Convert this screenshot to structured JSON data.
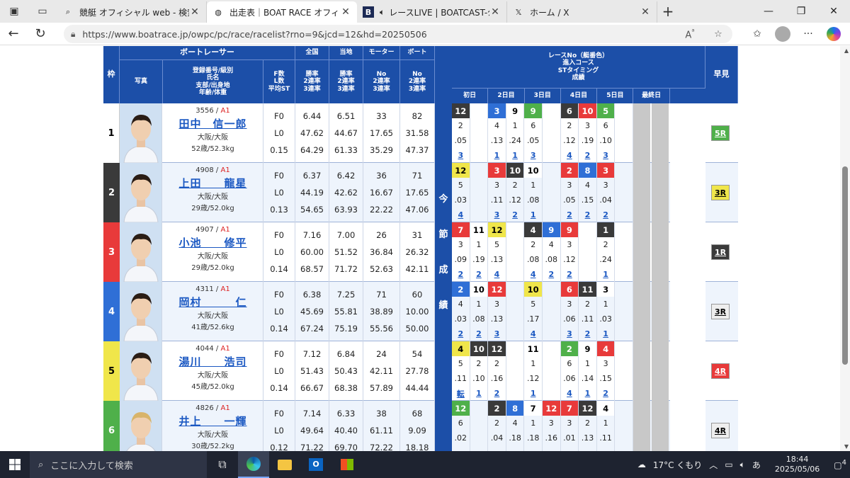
{
  "browser": {
    "tabs": [
      {
        "title": "競艇 オフィシャル web - 検索",
        "icon": "search-icon"
      },
      {
        "title": "出走表｜BOAT RACE オフィシャルウェブサイト",
        "icon": "globe-icon",
        "active": true
      },
      {
        "title": "レースLIVE | BOATCAST-公式ボートレース",
        "icon": "boatcast-icon"
      },
      {
        "title": "ホーム / X",
        "icon": "x-icon"
      }
    ],
    "url": "https://www.boatrace.jp/owpc/pc/race/racelist?rno=9&jcd=12&hd=20250506"
  },
  "header": {
    "waku": "枠",
    "boatracer": "ボートレーサー",
    "photo": "写真",
    "racer_sub": [
      "登録番号/級別",
      "氏名",
      "支部/出身地",
      "年齢/体重"
    ],
    "fl": [
      "F数",
      "L数",
      "平均ST"
    ],
    "zenkoku": "全国",
    "touchi": "当地",
    "motor": "モーター",
    "boat": "ボート",
    "rate_sub": [
      "勝率",
      "2連率",
      "3連率"
    ],
    "no_sub": [
      "No",
      "2連率",
      "3連率"
    ],
    "races_title": [
      "レースNo（艇番色）",
      "進入コース",
      "STタイミング",
      "成績"
    ],
    "days": [
      "初日",
      "2日目",
      "3日目",
      "4日目",
      "5日目",
      "最終日"
    ],
    "hayami": "早見",
    "konsetsu": [
      "今",
      "節",
      "成",
      "績"
    ]
  },
  "racers": [
    {
      "waku": "1",
      "reg": "3556",
      "cls": "A1",
      "name": "田中　信一郎",
      "branch": "大阪/大阪",
      "agewt": "52歳/52.3kg",
      "fl": [
        "F0",
        "L0",
        "0.15"
      ],
      "zenkoku": [
        "6.44",
        "47.62",
        "64.29"
      ],
      "touchi": [
        "6.51",
        "44.67",
        "61.33"
      ],
      "motor": [
        "33",
        "17.65",
        "35.29"
      ],
      "boat": [
        "82",
        "31.58",
        "47.37"
      ],
      "hayami": "5R",
      "races": [
        [
          "12",
          "",
          "3",
          "9",
          "9",
          "",
          "6",
          "10",
          "5",
          "",
          "",
          ""
        ],
        [
          "2",
          "",
          "4",
          "1",
          "6",
          "",
          "2",
          "3",
          "6",
          "",
          "",
          ""
        ],
        [
          ".05",
          "",
          ".13",
          ".24",
          ".05",
          "",
          ".12",
          ".19",
          ".10",
          "",
          "",
          ""
        ],
        [
          "3",
          "",
          "1",
          "1",
          "3",
          "",
          "4",
          "2",
          "3",
          "",
          "",
          ""
        ]
      ]
    },
    {
      "waku": "2",
      "reg": "4908",
      "cls": "A1",
      "name": "上田　　龍星",
      "branch": "大阪/大阪",
      "agewt": "29歳/52.0kg",
      "fl": [
        "F0",
        "L0",
        "0.13"
      ],
      "zenkoku": [
        "6.37",
        "44.19",
        "54.65"
      ],
      "touchi": [
        "6.42",
        "42.62",
        "63.93"
      ],
      "motor": [
        "36",
        "16.67",
        "22.22"
      ],
      "boat": [
        "71",
        "17.65",
        "47.06"
      ],
      "hayami": "3R",
      "races": [
        [
          "12",
          "",
          "3",
          "10",
          "10",
          "",
          "2",
          "8",
          "3",
          "",
          "",
          ""
        ],
        [
          "5",
          "",
          "3",
          "2",
          "1",
          "",
          "3",
          "4",
          "3",
          "",
          "",
          ""
        ],
        [
          ".03",
          "",
          ".11",
          ".12",
          ".08",
          "",
          ".05",
          ".15",
          ".04",
          "",
          "",
          ""
        ],
        [
          "4",
          "",
          "3",
          "2",
          "1",
          "",
          "2",
          "2",
          "2",
          "",
          "",
          ""
        ]
      ]
    },
    {
      "waku": "3",
      "reg": "4907",
      "cls": "A1",
      "name": "小池　　修平",
      "branch": "大阪/大阪",
      "agewt": "29歳/52.0kg",
      "fl": [
        "F0",
        "L0",
        "0.14"
      ],
      "zenkoku": [
        "7.16",
        "60.00",
        "68.57"
      ],
      "touchi": [
        "7.00",
        "51.52",
        "71.72"
      ],
      "motor": [
        "26",
        "36.84",
        "52.63"
      ],
      "boat": [
        "31",
        "26.32",
        "42.11"
      ],
      "hayami": "1R",
      "races": [
        [
          "7",
          "11",
          "12",
          "",
          "4",
          "9",
          "9",
          "",
          "1",
          "",
          "",
          ""
        ],
        [
          "3",
          "1",
          "5",
          "",
          "2",
          "4",
          "3",
          "",
          "2",
          "",
          "",
          ""
        ],
        [
          ".09",
          ".19",
          ".13",
          "",
          ".08",
          ".08",
          ".12",
          "",
          ".24",
          "",
          "",
          ""
        ],
        [
          "2",
          "2",
          "4",
          "",
          "4",
          "2",
          "2",
          "",
          "1",
          "",
          "",
          ""
        ]
      ]
    },
    {
      "waku": "4",
      "reg": "4311",
      "cls": "A1",
      "name": "岡村　　　仁",
      "branch": "大阪/大阪",
      "agewt": "41歳/52.6kg",
      "fl": [
        "F0",
        "L0",
        "0.14"
      ],
      "zenkoku": [
        "6.38",
        "45.69",
        "67.24"
      ],
      "touchi": [
        "7.25",
        "55.81",
        "75.19"
      ],
      "motor": [
        "71",
        "38.89",
        "55.56"
      ],
      "boat": [
        "60",
        "10.00",
        "50.00"
      ],
      "hayami": "3R",
      "races": [
        [
          "2",
          "10",
          "12",
          "",
          "10",
          "",
          "6",
          "11",
          "3",
          "",
          "",
          ""
        ],
        [
          "4",
          "1",
          "3",
          "",
          "5",
          "",
          "3",
          "2",
          "1",
          "",
          "",
          ""
        ],
        [
          ".03",
          ".08",
          ".13",
          "",
          ".17",
          "",
          ".06",
          ".11",
          ".03",
          "",
          "",
          ""
        ],
        [
          "2",
          "2",
          "3",
          "",
          "4",
          "",
          "3",
          "2",
          "1",
          "",
          "",
          ""
        ]
      ]
    },
    {
      "waku": "5",
      "reg": "4044",
      "cls": "A1",
      "name": "湯川　　浩司",
      "branch": "大阪/大阪",
      "agewt": "45歳/52.0kg",
      "fl": [
        "F0",
        "L0",
        "0.14"
      ],
      "zenkoku": [
        "7.12",
        "51.43",
        "66.67"
      ],
      "touchi": [
        "6.84",
        "50.43",
        "68.38"
      ],
      "motor": [
        "24",
        "42.11",
        "57.89"
      ],
      "boat": [
        "54",
        "27.78",
        "44.44"
      ],
      "hayami": "4R",
      "races": [
        [
          "4",
          "10",
          "12",
          "",
          "11",
          "",
          "2",
          "9",
          "4",
          "",
          "",
          ""
        ],
        [
          "5",
          "2",
          "2",
          "",
          "1",
          "",
          "6",
          "1",
          "3",
          "",
          "",
          ""
        ],
        [
          ".11",
          ".10",
          ".16",
          "",
          ".12",
          "",
          ".06",
          ".14",
          ".15",
          "",
          "",
          ""
        ],
        [
          "転",
          "1",
          "2",
          "",
          "1",
          "",
          "4",
          "1",
          "2",
          "",
          "",
          ""
        ]
      ]
    },
    {
      "waku": "6",
      "reg": "4826",
      "cls": "A1",
      "name": "井上　　一輝",
      "branch": "大阪/大阪",
      "agewt": "30歳/52.2kg",
      "fl": [
        "F0",
        "L0",
        "0.12"
      ],
      "zenkoku": [
        "7.14",
        "49.64",
        "71.22"
      ],
      "touchi": [
        "6.33",
        "40.40",
        "69.70"
      ],
      "motor": [
        "38",
        "61.11",
        "72.22"
      ],
      "boat": [
        "68",
        "9.09",
        "18.18"
      ],
      "hayami": "4R",
      "races": [
        [
          "12",
          "",
          "2",
          "8",
          "7",
          "12",
          "7",
          "12",
          "4",
          "",
          "",
          ""
        ],
        [
          "6",
          "",
          "2",
          "4",
          "1",
          "3",
          "3",
          "2",
          "1",
          "",
          "",
          ""
        ],
        [
          ".02",
          "",
          ".04",
          ".18",
          ".18",
          ".16",
          ".01",
          ".13",
          ".11",
          "",
          "",
          ""
        ],
        [
          "",
          "",
          "",
          "",
          "",
          "",
          "",
          "",
          "",
          "",
          "",
          ""
        ]
      ]
    }
  ],
  "colors": {
    "header_blue": "#1c4fa8",
    "waku1": "#ffffff",
    "waku2": "#3a3a3a",
    "waku3": "#e83a3a",
    "waku4": "#2f6fd6",
    "waku5": "#f0e64a",
    "waku6": "#4fb04a"
  },
  "taskbar": {
    "search_placeholder": "ここに入力して検索",
    "weather": "17°C くもり",
    "time": "18:44",
    "date": "2025/05/06",
    "ime": "あ",
    "notifications": "4"
  }
}
